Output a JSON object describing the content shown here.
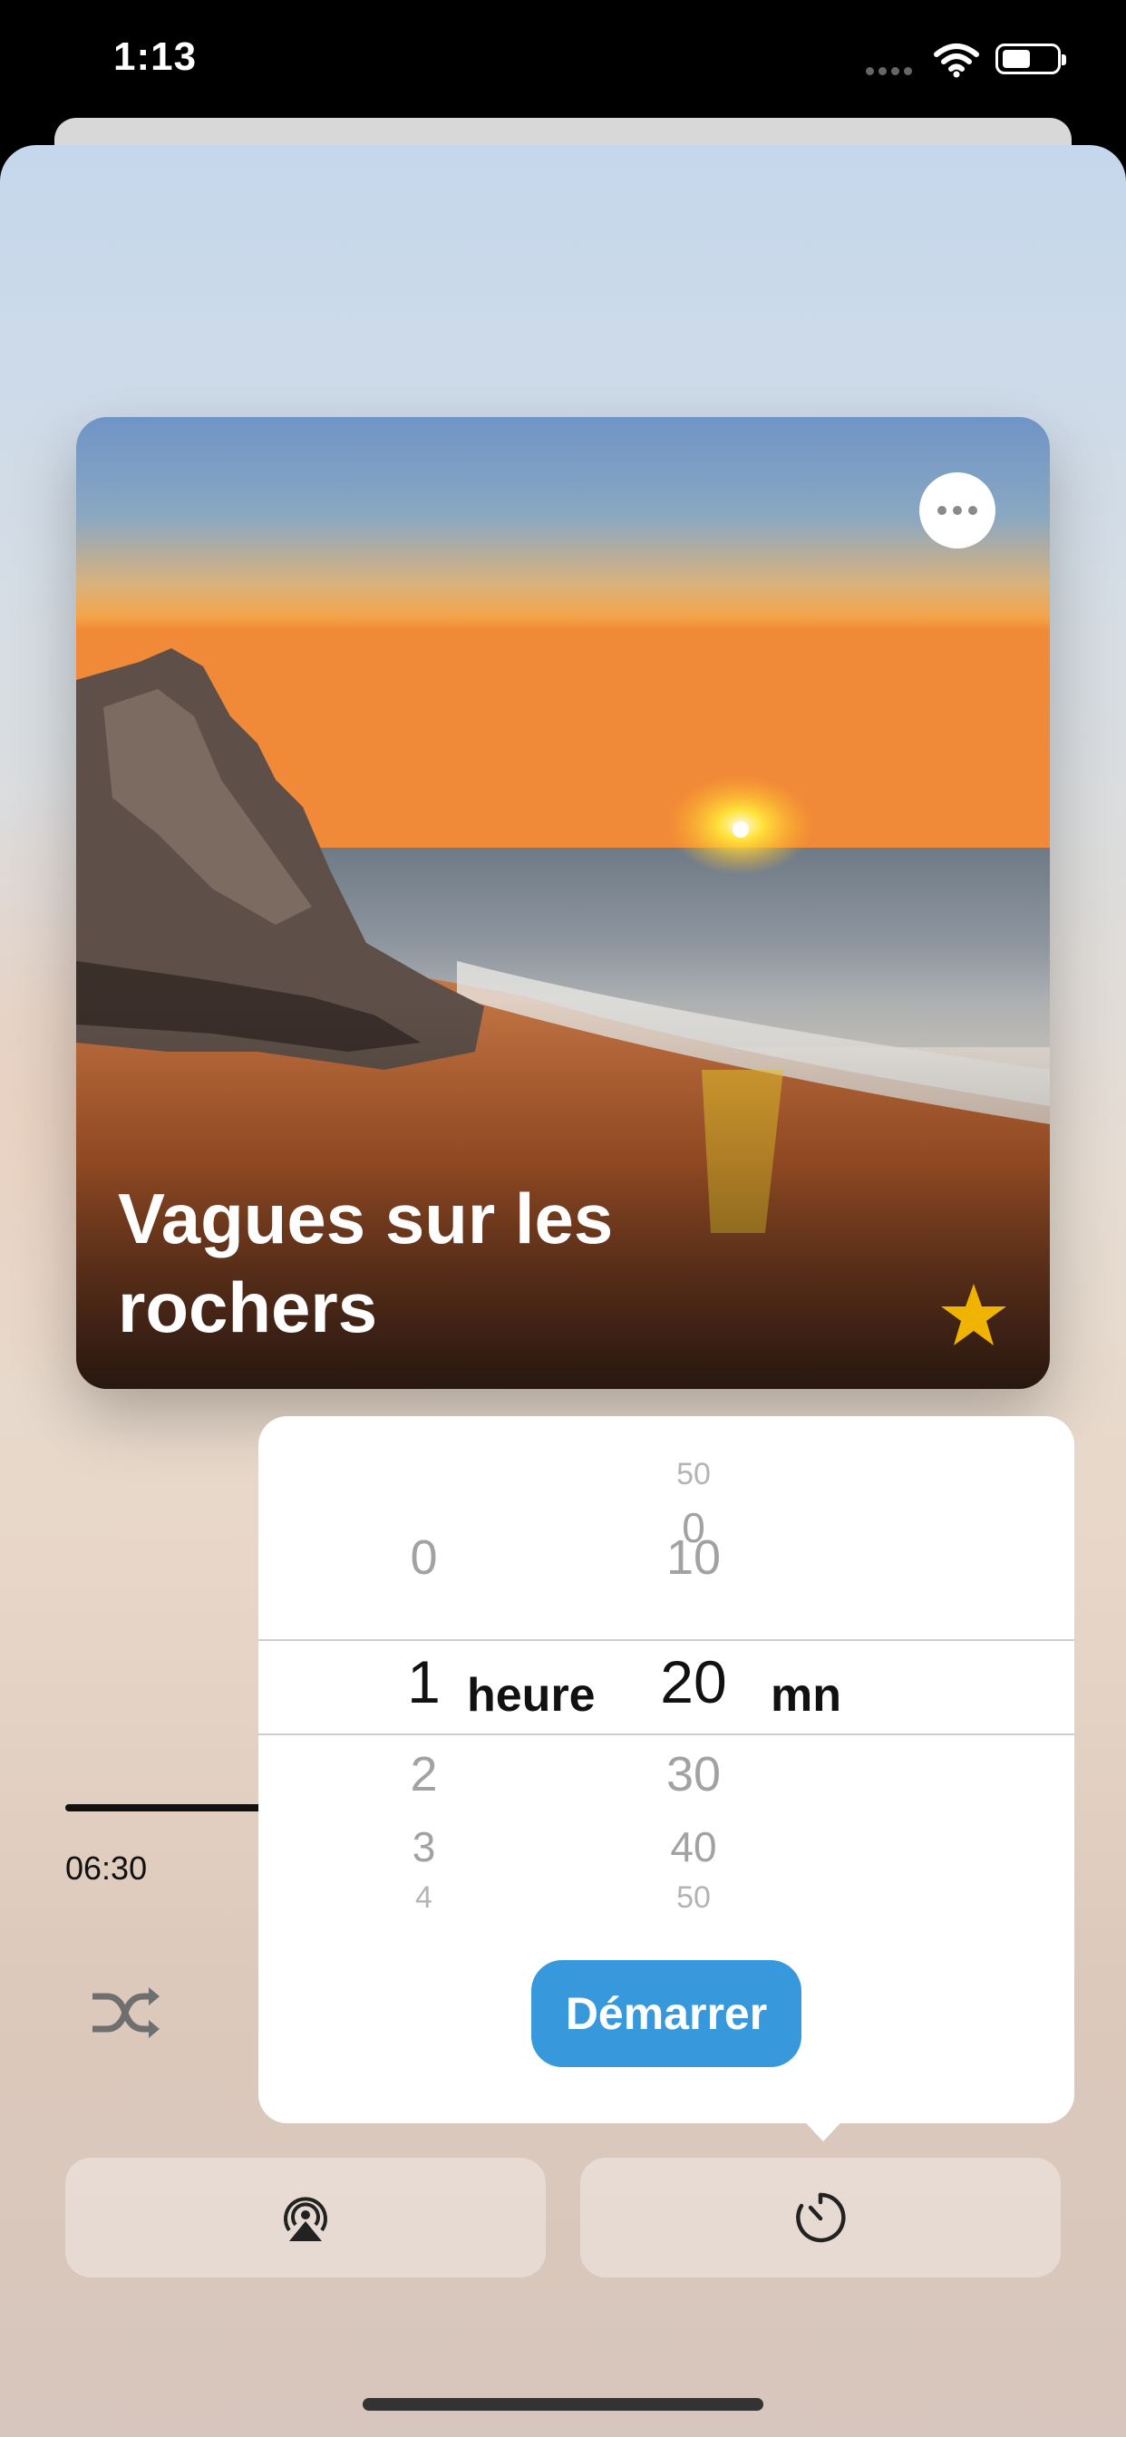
{
  "status_bar": {
    "time": "1:13"
  },
  "artwork": {
    "title": "Vagues sur les rochers"
  },
  "player": {
    "elapsed": "06:30",
    "progress": 0.2
  },
  "timer_picker": {
    "hours": [
      "0",
      "1",
      "2",
      "3",
      "4"
    ],
    "minutes": [
      "50",
      "0",
      "10",
      "20",
      "30",
      "40",
      "50"
    ],
    "selected_hours": "1",
    "selected_minutes": "20",
    "hours_unit": "heure",
    "minutes_unit": "mn",
    "start_label": "Démarrer"
  },
  "bottom_bar": {
    "left_icon": "airplay-icon",
    "right_icon": "timer-icon"
  },
  "colors": {
    "accent": "#3898dc",
    "star": "#f0b400"
  }
}
